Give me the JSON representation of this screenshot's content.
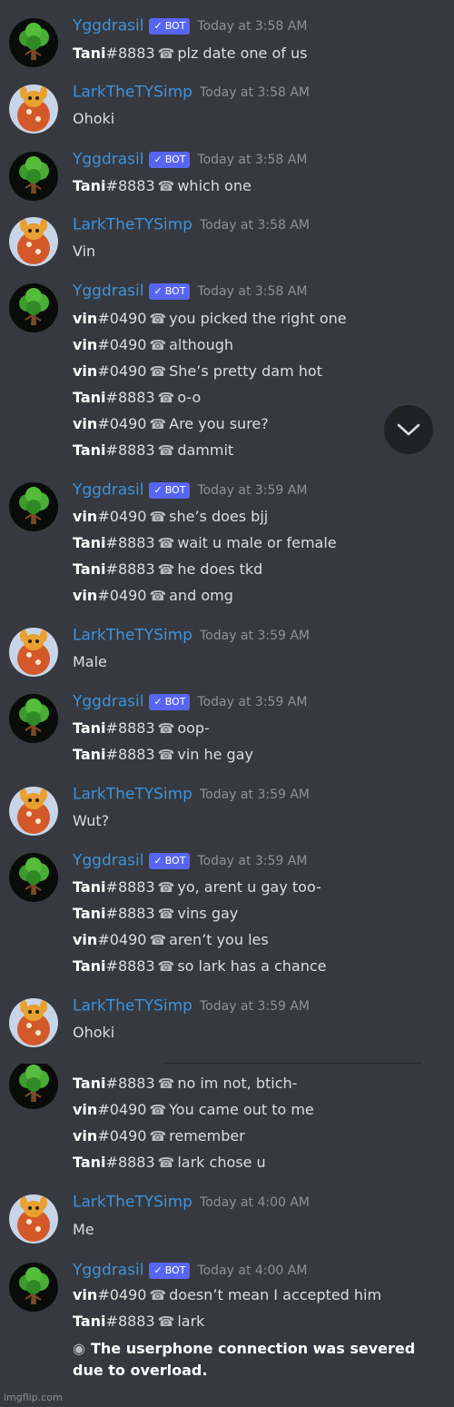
{
  "users": {
    "bot": {
      "name": "Yggdrasil",
      "badge": "BOT"
    },
    "lark": {
      "name": "LarkTheTYSimp"
    }
  },
  "messages": [
    {
      "author": "Yggdrasil",
      "badge": "BOT",
      "time": "Today at 3:58 AM",
      "lines": [
        {
          "user": "Tani",
          "disc": "#8883",
          "text": "plz date one of us"
        }
      ]
    },
    {
      "author": "LarkTheTYSimp",
      "time": "Today at 3:58 AM",
      "text": "Ohoki"
    },
    {
      "author": "Yggdrasil",
      "badge": "BOT",
      "time": "Today at 3:58 AM",
      "lines": [
        {
          "user": "Tani",
          "disc": "#8883",
          "text": "which one"
        }
      ]
    },
    {
      "author": "LarkTheTYSimp",
      "time": "Today at 3:58 AM",
      "text": "Vin"
    },
    {
      "author": "Yggdrasil",
      "badge": "BOT",
      "time": "Today at 3:58 AM",
      "lines": [
        {
          "user": "vin",
          "disc": "#0490",
          "text": "you picked the right one"
        },
        {
          "user": "vin",
          "disc": "#0490",
          "text": "although"
        },
        {
          "user": "vin",
          "disc": "#0490",
          "text": "She’s pretty dam hot"
        },
        {
          "user": "Tani",
          "disc": "#8883",
          "text": "o-o"
        },
        {
          "user": "vin",
          "disc": "#0490",
          "text": "Are you sure?"
        },
        {
          "user": "Tani",
          "disc": "#8883",
          "text": "dammit"
        }
      ]
    },
    {
      "author": "Yggdrasil",
      "badge": "BOT",
      "time": "Today at 3:59 AM",
      "lines": [
        {
          "user": "vin",
          "disc": "#0490",
          "text": "she’s does bjj"
        },
        {
          "user": "Tani",
          "disc": "#8883",
          "text": "wait u male or female"
        },
        {
          "user": "Tani",
          "disc": "#8883",
          "text": "he does tkd"
        },
        {
          "user": "vin",
          "disc": "#0490",
          "text": "and omg"
        }
      ]
    },
    {
      "author": "LarkTheTYSimp",
      "time": "Today at 3:59 AM",
      "text": "Male"
    },
    {
      "author": "Yggdrasil",
      "badge": "BOT",
      "time": "Today at 3:59 AM",
      "lines": [
        {
          "user": "Tani",
          "disc": "#8883",
          "text": "oop-"
        },
        {
          "user": "Tani",
          "disc": "#8883",
          "text": "vin he gay"
        }
      ]
    },
    {
      "author": "LarkTheTYSimp",
      "time": "Today at 3:59 AM",
      "text": "Wut?"
    },
    {
      "author": "Yggdrasil",
      "badge": "BOT",
      "time": "Today at 3:59 AM",
      "lines": [
        {
          "user": "Tani",
          "disc": "#8883",
          "text": "yo, arent u gay too-"
        },
        {
          "user": "Tani",
          "disc": "#8883",
          "text": "vins gay"
        },
        {
          "user": "vin",
          "disc": "#0490",
          "text": "aren’t you les"
        },
        {
          "user": "Tani",
          "disc": "#8883",
          "text": "so lark has a chance"
        }
      ]
    },
    {
      "author": "LarkTheTYSimp",
      "time": "Today at 3:59 AM",
      "text": "Ohoki"
    },
    {
      "author": "Yggdrasil",
      "badge": "BOT",
      "time": "",
      "lines": [
        {
          "user": "Tani",
          "disc": "#8883",
          "text": "no im not, btich-"
        },
        {
          "user": "vin",
          "disc": "#0490",
          "text": "You came out to me"
        },
        {
          "user": "vin",
          "disc": "#0490",
          "text": "remember"
        },
        {
          "user": "Tani",
          "disc": "#8883",
          "text": "lark chose u"
        }
      ]
    },
    {
      "author": "LarkTheTYSimp",
      "time": "Today at 4:00 AM",
      "text": "Me"
    },
    {
      "author": "Yggdrasil",
      "badge": "BOT",
      "time": "Today at 4:00 AM",
      "lines": [
        {
          "user": "vin",
          "disc": "#0490",
          "text": "doesn’t mean I accepted him"
        },
        {
          "user": "Tani",
          "disc": "#8883",
          "text": "lark"
        }
      ],
      "system": "The userphone connection was severed due to overload."
    }
  ],
  "icons": {
    "phone": "phone-icon",
    "jump": "chevron-down-icon",
    "system": "eye-icon"
  },
  "colors": {
    "background": "#36393f",
    "username": "#3d93dc",
    "badge": "#5865f2"
  },
  "watermark": "imgflip.com"
}
